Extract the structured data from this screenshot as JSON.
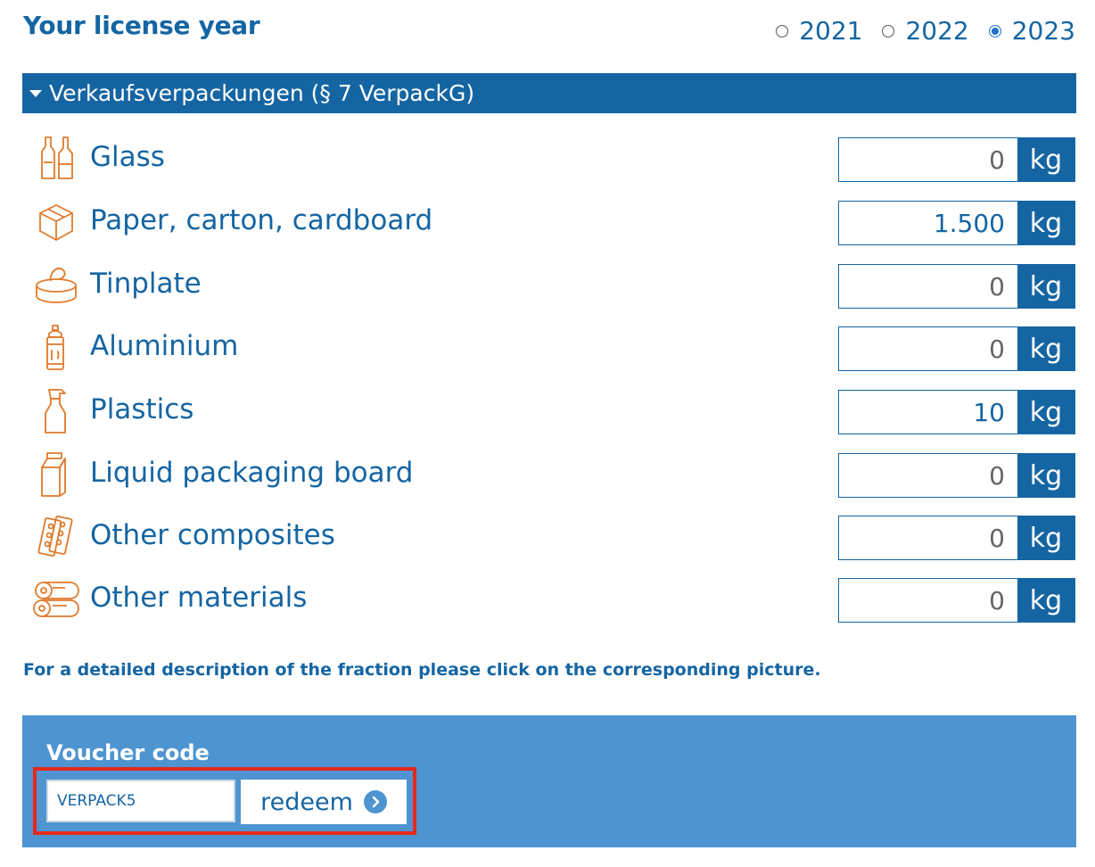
{
  "header": {
    "title": "Your license year",
    "years": [
      {
        "label": "2021",
        "selected": false
      },
      {
        "label": "2022",
        "selected": false
      },
      {
        "label": "2023",
        "selected": true
      }
    ]
  },
  "section": {
    "title": "Verkaufsverpackungen (§ 7 VerpackG)"
  },
  "materials": [
    {
      "label": "Glass",
      "value": "0",
      "unit": "kg",
      "icon": "glass-bottles-icon"
    },
    {
      "label": "Paper, carton, cardboard",
      "value": "1.500",
      "unit": "kg",
      "icon": "box-icon"
    },
    {
      "label": "Tinplate",
      "value": "0",
      "unit": "kg",
      "icon": "tin-can-icon"
    },
    {
      "label": "Aluminium",
      "value": "0",
      "unit": "kg",
      "icon": "spray-can-icon"
    },
    {
      "label": "Plastics",
      "value": "10",
      "unit": "kg",
      "icon": "spray-bottle-icon"
    },
    {
      "label": "Liquid packaging board",
      "value": "0",
      "unit": "kg",
      "icon": "milk-carton-icon"
    },
    {
      "label": "Other composites",
      "value": "0",
      "unit": "kg",
      "icon": "blister-pack-icon"
    },
    {
      "label": "Other materials",
      "value": "0",
      "unit": "kg",
      "icon": "rolls-icon"
    }
  ],
  "hint": "For a detailed description of the fraction please click on the corresponding picture.",
  "voucher": {
    "label": "Voucher code",
    "code": "VERPACK5",
    "button_label": "redeem"
  },
  "colors": {
    "primary": "#1565a3",
    "voucher_bg": "#4e94d0",
    "icon": "#e07a2b",
    "highlight": "#e8281c"
  }
}
